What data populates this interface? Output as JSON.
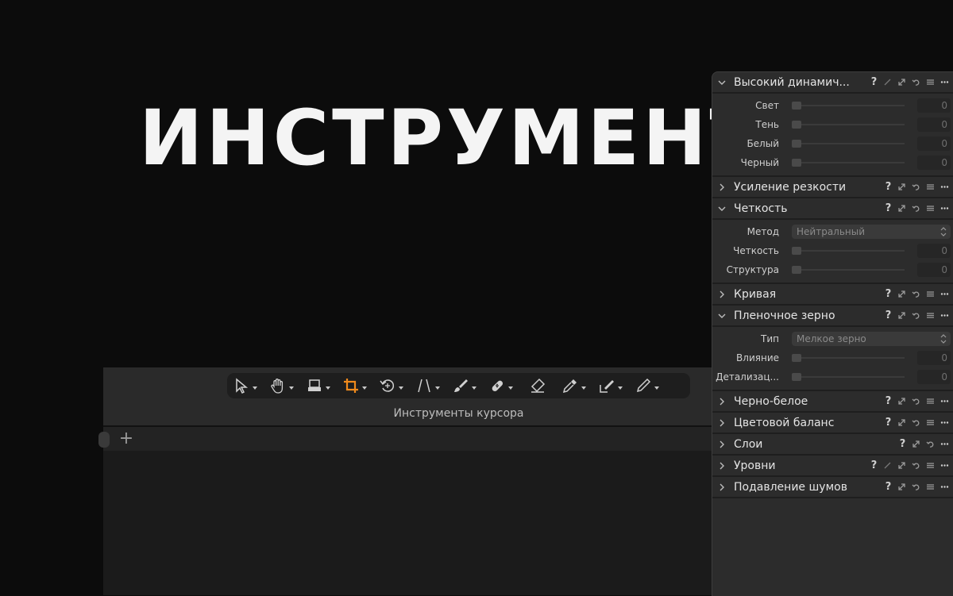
{
  "hero_title": "ИНСТРУМЕНТЫ",
  "toolbar": {
    "caption": "Инструменты курсора",
    "tools": [
      {
        "icon": "cursor-select-icon",
        "active": false
      },
      {
        "icon": "hand-pan-icon",
        "active": false
      },
      {
        "icon": "stamp-icon",
        "active": false
      },
      {
        "icon": "crop-icon",
        "active": true
      },
      {
        "icon": "rotate-icon",
        "active": false
      },
      {
        "icon": "keystone-icon",
        "active": false
      },
      {
        "icon": "brush-icon",
        "active": false
      },
      {
        "icon": "healing-patch-icon",
        "active": false
      },
      {
        "icon": "eraser-icon",
        "active": false
      },
      {
        "icon": "eyedropper-icon",
        "active": false
      },
      {
        "icon": "pick-brush-icon",
        "active": false
      },
      {
        "icon": "pen-annotate-icon",
        "active": false
      }
    ]
  },
  "tabs": {
    "add_label": "+"
  },
  "colors": {
    "accent": "#f08a1c",
    "panel": "#2c2c2c",
    "background": "#0c0c0c"
  },
  "panel": {
    "hdr": {
      "title": "Высокий динамич...",
      "rows": [
        {
          "label": "Свет",
          "value": "0"
        },
        {
          "label": "Тень",
          "value": "0"
        },
        {
          "label": "Белый",
          "value": "0"
        },
        {
          "label": "Черный",
          "value": "0"
        }
      ]
    },
    "sharpen": {
      "title": "Усиление резкости"
    },
    "clarity": {
      "title": "Четкость",
      "method_label": "Метод",
      "method_value": "Нейтральный",
      "rows": [
        {
          "label": "Четкость",
          "value": "0"
        },
        {
          "label": "Структура",
          "value": "0"
        }
      ]
    },
    "curve": {
      "title": "Кривая"
    },
    "grain": {
      "title": "Пленочное зерно",
      "type_label": "Тип",
      "type_value": "Мелкое зерно",
      "rows": [
        {
          "label": "Влияние",
          "value": "0"
        },
        {
          "label": "Детализац...",
          "value": "0"
        }
      ]
    },
    "bw": {
      "title": "Черно-белое"
    },
    "color_balance": {
      "title": "Цветовой баланс"
    },
    "layers": {
      "title": "Слои"
    },
    "levels": {
      "title": "Уровни"
    },
    "noise": {
      "title": "Подавление шумов"
    }
  }
}
